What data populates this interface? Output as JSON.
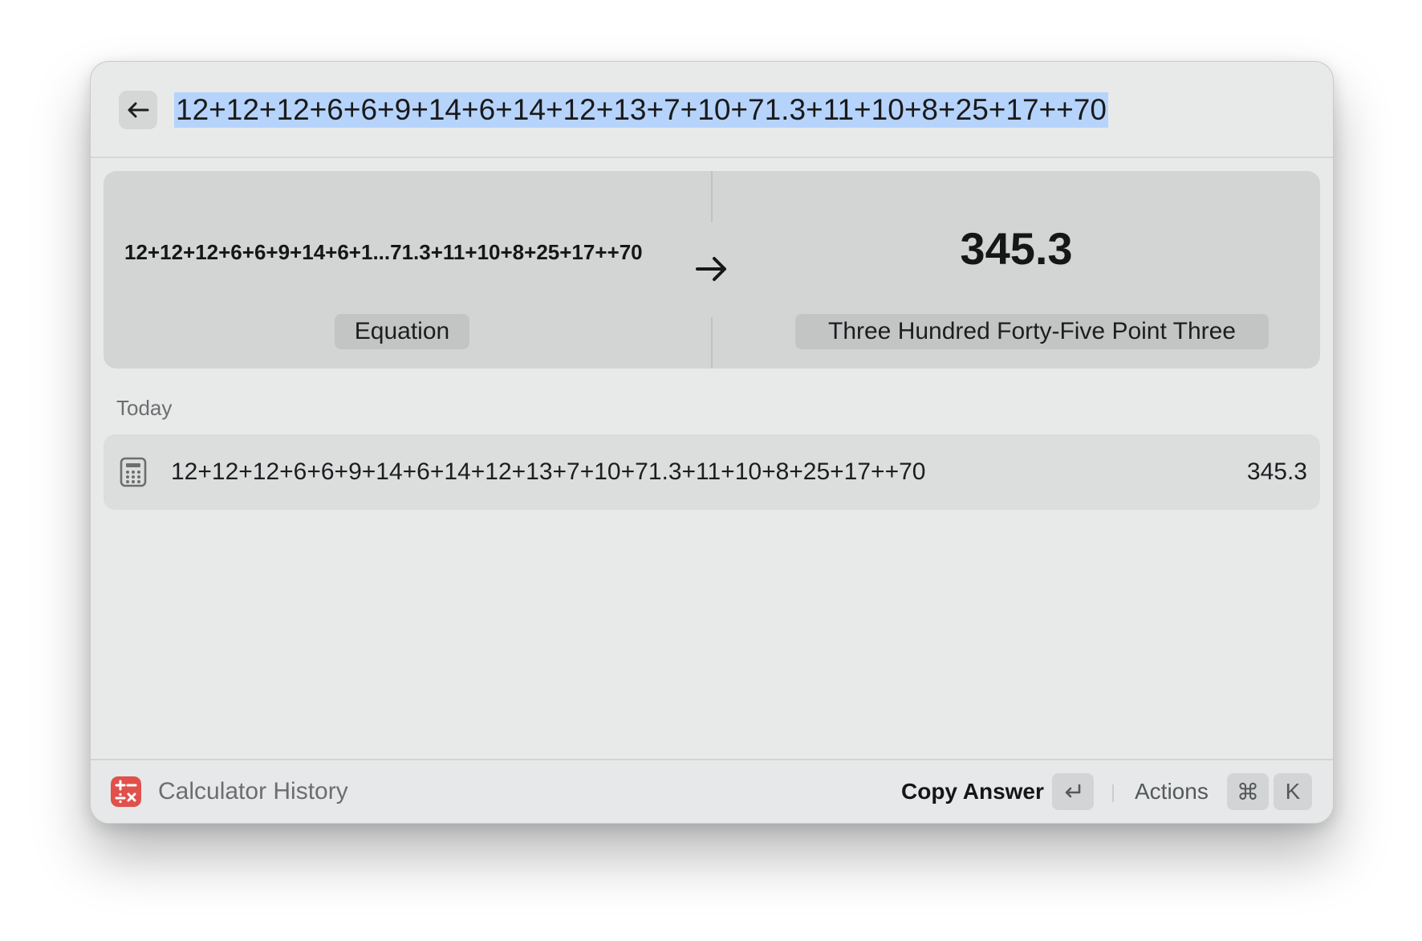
{
  "search": {
    "query": "12+12+12+6+6+9+14+6+14+12+13+7+10+71.3+11+10+8+25+17++70"
  },
  "result": {
    "equation_display": "12+12+12+6+6+9+14+6+1...71.3+11+10+8+25+17++70",
    "answer": "345.3",
    "equation_label": "Equation",
    "answer_words": "Three Hundred Forty-Five Point Three"
  },
  "history": {
    "section_title": "Today",
    "items": [
      {
        "expression": "12+12+12+6+6+9+14+6+14+12+13+7+10+71.3+11+10+8+25+17++70",
        "value": "345.3",
        "icon": "calculator-icon"
      }
    ]
  },
  "footer": {
    "app_name": "Calculator History",
    "app_icon": "calculator-app-icon",
    "primary_action": "Copy Answer",
    "primary_shortcut": "↵",
    "actions_label": "Actions",
    "actions_shortcut_mod": "⌘",
    "actions_shortcut_key": "K"
  },
  "colors": {
    "selection": "#b6d3fb",
    "app_icon": "#e0514b",
    "window_bg": "#e8eaea"
  }
}
